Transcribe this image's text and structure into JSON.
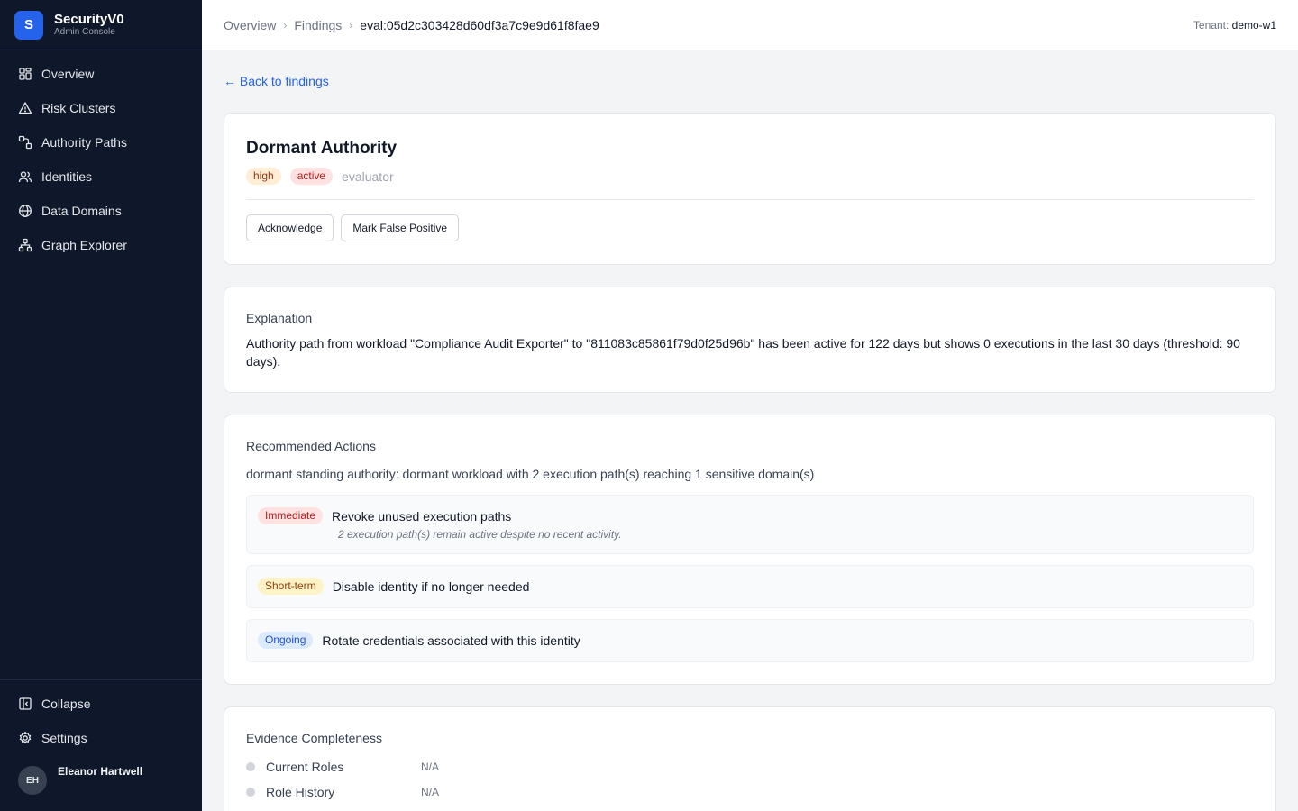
{
  "brand": {
    "logo_letter": "S",
    "name": "SecurityV0",
    "subtitle": "Admin Console"
  },
  "sidebar": {
    "items": [
      {
        "label": "Overview",
        "icon": "grid-icon"
      },
      {
        "label": "Risk Clusters",
        "icon": "warning-triangle-icon"
      },
      {
        "label": "Authority Paths",
        "icon": "route-icon"
      },
      {
        "label": "Identities",
        "icon": "users-icon"
      },
      {
        "label": "Data Domains",
        "icon": "globe-icon"
      },
      {
        "label": "Graph Explorer",
        "icon": "graph-nodes-icon"
      }
    ],
    "bottom": {
      "collapse_label": "Collapse",
      "settings_label": "Settings"
    },
    "user": {
      "initials": "EH",
      "name": "Eleanor Hartwell"
    }
  },
  "topbar": {
    "breadcrumbs": [
      "Overview",
      "Findings",
      "eval:05d2c303428d60df3a7c9e9d61f8fae9"
    ],
    "tenant_label": "Tenant:",
    "tenant_value": "demo-w1"
  },
  "back_link": "← Back to findings",
  "finding": {
    "title": "Dormant Authority",
    "severity": "high",
    "status": "active",
    "source": "evaluator",
    "actions": {
      "acknowledge": "Acknowledge",
      "false_positive": "Mark False Positive"
    }
  },
  "explanation": {
    "label": "Explanation",
    "text": "Authority path from workload \"Compliance Audit Exporter\" to \"811083c85861f79d0f25d96b\" has been active for 122 days but shows 0 executions in the last 30 days (threshold: 90 days)."
  },
  "recommendations": {
    "label": "Recommended Actions",
    "summary": "dormant standing authority: dormant workload with 2 execution path(s) reaching 1 sensitive domain(s)",
    "items": [
      {
        "priority": "Immediate",
        "title": "Revoke unused execution paths",
        "description": "2 execution path(s) remain active despite no recent activity."
      },
      {
        "priority": "Short-term",
        "title": "Disable identity if no longer needed"
      },
      {
        "priority": "Ongoing",
        "title": "Rotate credentials associated with this identity"
      }
    ]
  },
  "evidence": {
    "label": "Evidence Completeness",
    "items": [
      {
        "label": "Current Roles",
        "value": "N/A"
      },
      {
        "label": "Role History",
        "value": "N/A"
      }
    ]
  },
  "colors": {
    "sidebar_bg": "#0f172a",
    "accent": "#2563eb",
    "severity_high": "#9a3412",
    "status_active": "#b91c1c"
  }
}
